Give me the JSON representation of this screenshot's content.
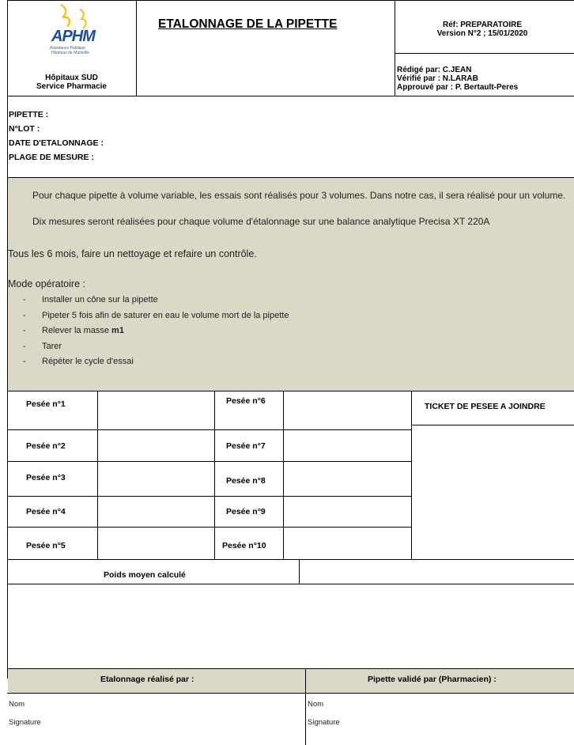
{
  "header": {
    "logo_text": "APHM",
    "logo_sub": [
      "Assistance Publique",
      "Hôpitaux de Marseille"
    ],
    "org_line1": "Hôpitaux SUD",
    "org_line2": "Service Pharmacie",
    "title": "ETALONNAGE DE LA PIPETTE",
    "ref": "Réf: PREPARATOIRE",
    "version": "Version N°2 ; 15/01/2020",
    "redige": "Rédigé par: C.JEAN",
    "verifie": "Vérifié par : N.LARAB",
    "approuve": "Approuvé par : P. Bertault-Peres"
  },
  "fields": {
    "pipette": "PIPETTE :",
    "lot": "N°LOT :",
    "date": "DATE D'ETALONNAGE :",
    "plage": "PLAGE DE MESURE :"
  },
  "instructions": {
    "bullet1": "Pour chaque pipette à volume variable, les essais sont réalisés pour 3 volumes. Dans notre cas, il sera réalisé pour un volume.",
    "bullet2": "Dix mesures seront réalisées pour chaque volume d'étalonnage sur une balance analytique Precisa XT 220A",
    "frequency": "Tous les 6 mois, faire un nettoyage et refaire un contrôle.",
    "mode_title": "Mode opératoire :",
    "steps": [
      "Installer un cône sur la pipette",
      "Pipeter 5 fois afin de saturer en eau le volume mort de la pipette",
      "Relever la masse",
      "Tarer",
      "Répéter le cycle d'essai"
    ],
    "step3_bold": "m1"
  },
  "weighings": {
    "left": [
      "Pesée n°1",
      "Pesée n°2",
      "Pesée n°3",
      "Pesée n°4",
      "Pesée n°5"
    ],
    "right": [
      "Pesée n°6",
      "Pesée n°7",
      "Pesée n°8",
      "Pesée n°9",
      "Pesée n°10"
    ],
    "ticket": "TICKET DE PESEE A JOINDRE",
    "average": "Poids moyen calculé"
  },
  "signatures": {
    "left_title": "Etalonnage réalisé par :",
    "right_title": "Pipette validé par (Pharmacien) :",
    "nom": "Nom",
    "signature": "Signature"
  },
  "colors": {
    "beige": "#dcd8c8",
    "logo_blue": "#1a4e9a",
    "logo_yellow": "#f0c419"
  }
}
